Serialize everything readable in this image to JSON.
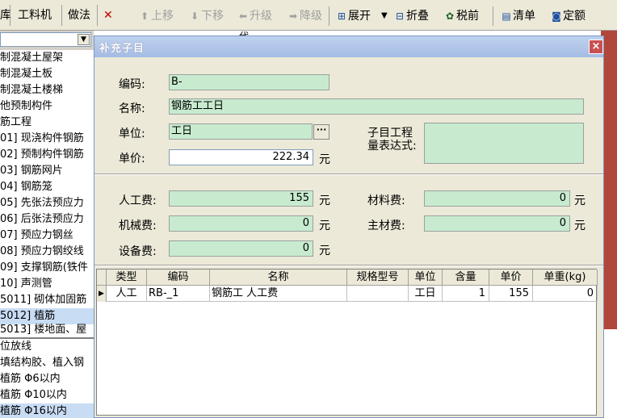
{
  "left_toolbar": {
    "item_a": "库",
    "item_b": "工料机",
    "item_c": "做法",
    "close": "✕"
  },
  "tree_items": [
    "制混凝土屋架",
    "制混凝土板",
    "制混凝土楼梯",
    "他预制构件",
    "筋工程",
    "01] 现浇构件钢筋",
    "02] 预制构件钢筋",
    "03] 钢筋网片",
    "04] 钢筋笼",
    "05] 先张法预应力",
    "06] 后张法预应力",
    "07] 预应力钢丝",
    "08] 预应力钢绞线",
    "09] 支撑钢筋(铁件",
    "10] 声测管",
    "5011] 砌体加固筋",
    "5012] 植筋",
    "5013] 楼地面、屋"
  ],
  "tree_items_lower": [
    "位放线",
    "填结构胶、植入钢",
    "植筋 Φ6以内",
    "植筋 Φ10以内",
    "植筋 Φ16以内"
  ],
  "toolbar": {
    "up": "上移",
    "down": "下移",
    "upgrade": "升级",
    "downgrade": "降级",
    "expand": "展开",
    "fold": "折叠",
    "pretax": "税前",
    "list": "清单",
    "quota": "定额"
  },
  "behind_stub": "代",
  "dialog": {
    "title": "补充子目",
    "close": "×",
    "code_label": "编码:",
    "code_value": "B-",
    "name_label": "名称:",
    "name_value": "钢筋工工日",
    "unit_label": "单位:",
    "unit_value": "工日",
    "browse": "···",
    "price_label": "单价:",
    "price_value": "222.34",
    "price_unit": "元",
    "expr_label_1": "子目工程",
    "expr_label_2": "量表达式:",
    "expr_value": "",
    "labor_label": "人工费:",
    "labor_value": "155",
    "labor_unit": "元",
    "machine_label": "机械费:",
    "machine_value": "0",
    "machine_unit": "元",
    "equip_label": "设备费:",
    "equip_value": "0",
    "equip_unit": "元",
    "material_label": "材料费:",
    "material_value": "0",
    "material_unit": "元",
    "main_material_label": "主材费:",
    "main_material_value": "0",
    "main_material_unit": "元"
  },
  "grid": {
    "headers": [
      "类型",
      "编码",
      "名称",
      "规格型号",
      "单位",
      "含量",
      "单价",
      "单重(kg)"
    ],
    "rows": [
      [
        "人工",
        "RB-_1",
        "钢筋工 人工费",
        "",
        "工日",
        "1",
        "155",
        "0"
      ]
    ]
  }
}
